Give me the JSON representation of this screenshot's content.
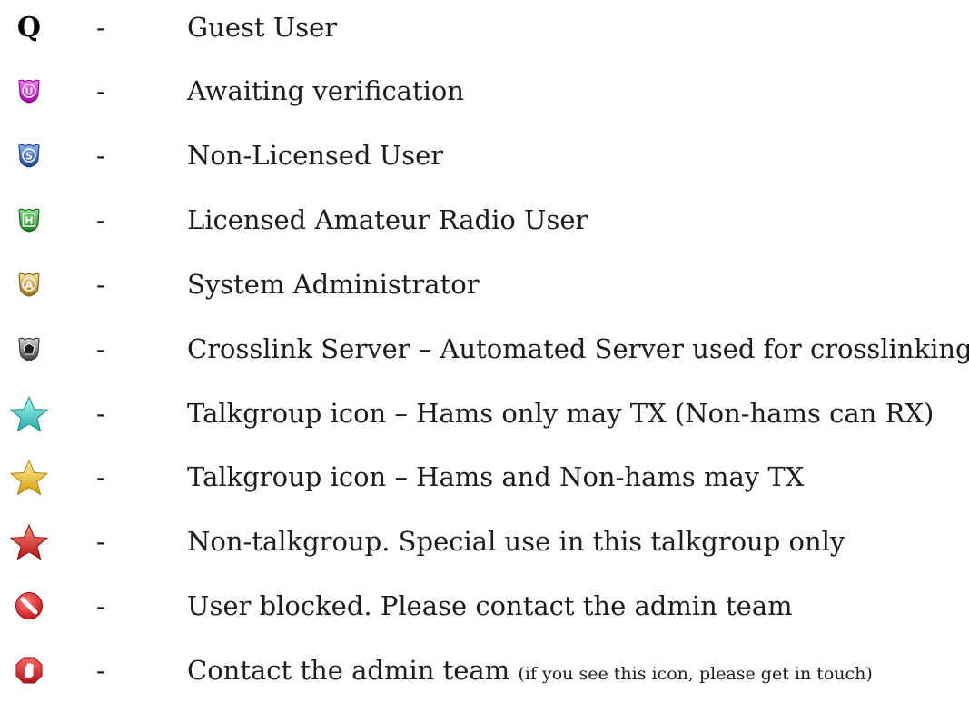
{
  "legend": {
    "separator": "-",
    "rows": [
      {
        "icon": "guest-q-icon",
        "icon_text": "Q",
        "label": "Guest User",
        "note": ""
      },
      {
        "icon": "badge-u-magenta-icon",
        "icon_text": "U",
        "icon_color": "#d41ad4",
        "label": "Awaiting verification",
        "note": ""
      },
      {
        "icon": "badge-s-blue-icon",
        "icon_text": "S",
        "icon_color": "#2f5fb8",
        "label": "Non-Licensed User",
        "note": ""
      },
      {
        "icon": "badge-h-green-icon",
        "icon_text": "H",
        "icon_color": "#2f9a2f",
        "label": "Licensed Amateur Radio User",
        "note": ""
      },
      {
        "icon": "badge-a-gold-icon",
        "icon_text": "A",
        "icon_color": "#c79a32",
        "label": "System Administrator",
        "note": ""
      },
      {
        "icon": "badge-crosslink-grey-icon",
        "icon_text": "",
        "icon_color": "#6d6d6d",
        "label": "Crosslink Server – Automated Server used for crosslinking",
        "note": ""
      },
      {
        "icon": "star-teal-icon",
        "icon_color": "#3ed6cd",
        "label": "Talkgroup icon – Hams only may TX (Non-hams can RX)",
        "note": ""
      },
      {
        "icon": "star-gold-icon",
        "icon_color": "#f2c21f",
        "label": "Talkgroup icon – Hams and Non-hams may TX",
        "note": ""
      },
      {
        "icon": "star-red-icon",
        "icon_color": "#d6231f",
        "label": "Non-talkgroup. Special use in this talkgroup only",
        "note": ""
      },
      {
        "icon": "blocked-icon",
        "icon_color": "#e0262a",
        "label": "User blocked. Please contact the admin team",
        "note": ""
      },
      {
        "icon": "stop-hand-icon",
        "icon_color": "#e0262a",
        "label": "Contact the admin team",
        "note": "(if you see this icon, please get in touch)"
      }
    ]
  }
}
